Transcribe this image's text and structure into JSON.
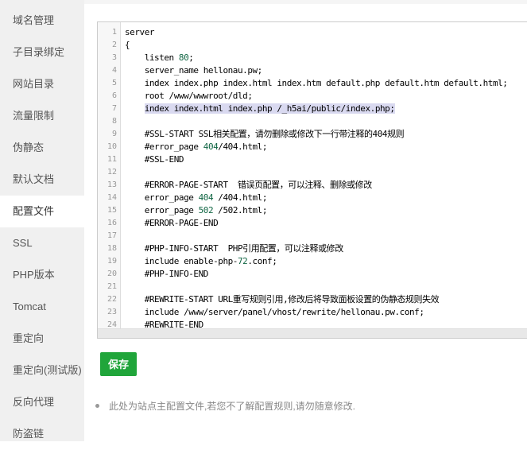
{
  "sidebar": {
    "items": [
      {
        "label": "域名管理",
        "active": false
      },
      {
        "label": "子目录绑定",
        "active": false
      },
      {
        "label": "网站目录",
        "active": false
      },
      {
        "label": "流量限制",
        "active": false
      },
      {
        "label": "伪静态",
        "active": false
      },
      {
        "label": "默认文档",
        "active": false
      },
      {
        "label": "配置文件",
        "active": true
      },
      {
        "label": "SSL",
        "active": false
      },
      {
        "label": "PHP版本",
        "active": false
      },
      {
        "label": "Tomcat",
        "active": false
      },
      {
        "label": "重定向",
        "active": false
      },
      {
        "label": "重定向(测试版)",
        "active": false
      },
      {
        "label": "反向代理",
        "active": false
      },
      {
        "label": "防盗链",
        "active": false
      }
    ]
  },
  "editor": {
    "highlighted_line": 7,
    "lines": [
      {
        "no": "1",
        "text": "server"
      },
      {
        "no": "2",
        "text": "{"
      },
      {
        "no": "3",
        "text": "    listen 80;"
      },
      {
        "no": "4",
        "text": "    server_name hellonau.pw;"
      },
      {
        "no": "5",
        "text": "    index index.php index.html index.htm default.php default.htm default.html;"
      },
      {
        "no": "6",
        "text": "    root /www/wwwroot/dld;"
      },
      {
        "no": "7",
        "text": "    index index.html index.php /_h5ai/public/index.php;"
      },
      {
        "no": "8",
        "text": ""
      },
      {
        "no": "9",
        "text": "    #SSL-START SSL相关配置，请勿删除或修改下一行带注释的404规则"
      },
      {
        "no": "10",
        "text": "    #error_page 404/404.html;"
      },
      {
        "no": "11",
        "text": "    #SSL-END"
      },
      {
        "no": "12",
        "text": ""
      },
      {
        "no": "13",
        "text": "    #ERROR-PAGE-START  错误页配置，可以注释、删除或修改"
      },
      {
        "no": "14",
        "text": "    error_page 404 /404.html;"
      },
      {
        "no": "15",
        "text": "    error_page 502 /502.html;"
      },
      {
        "no": "16",
        "text": "    #ERROR-PAGE-END"
      },
      {
        "no": "17",
        "text": ""
      },
      {
        "no": "18",
        "text": "    #PHP-INFO-START  PHP引用配置，可以注释或修改"
      },
      {
        "no": "19",
        "text": "    include enable-php-72.conf;"
      },
      {
        "no": "20",
        "text": "    #PHP-INFO-END"
      },
      {
        "no": "21",
        "text": ""
      },
      {
        "no": "22",
        "text": "    #REWRITE-START URL重写规则引用,修改后将导致面板设置的伪静态规则失效"
      },
      {
        "no": "23",
        "text": "    include /www/server/panel/vhost/rewrite/hellonau.pw.conf;"
      },
      {
        "no": "24",
        "text": "    #REWRITE-END"
      }
    ],
    "number_color": "#116644",
    "highlight_color": "#d9d9f0"
  },
  "actions": {
    "save_label": "保存",
    "save_color": "#20a53a"
  },
  "notes": [
    "此处为站点主配置文件,若您不了解配置规则,请勿随意修改."
  ]
}
